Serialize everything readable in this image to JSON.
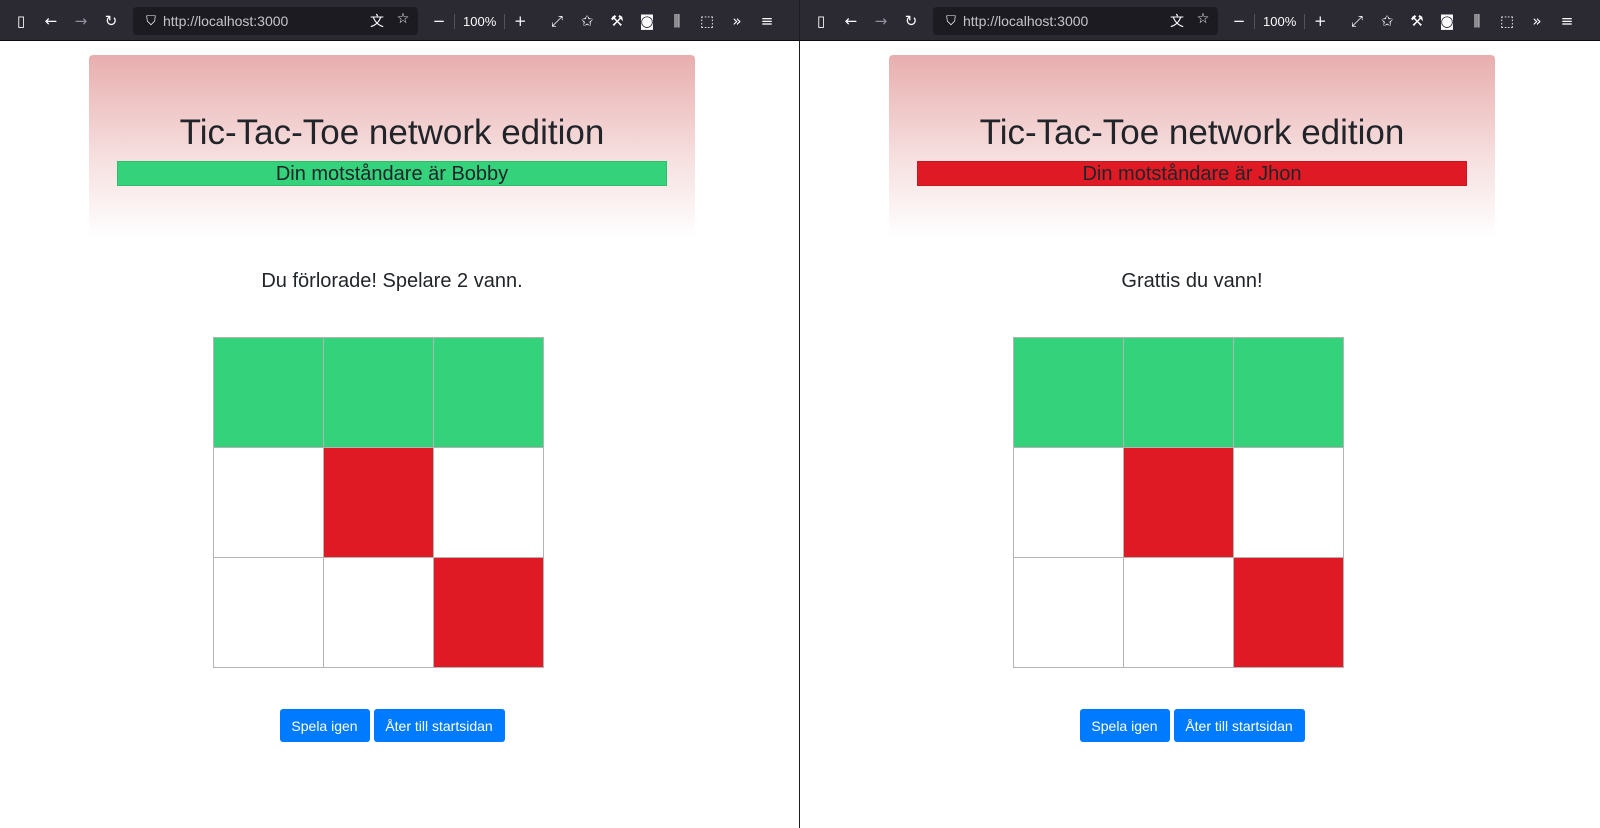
{
  "browser": {
    "url": "http://localhost:3000",
    "zoom": "100%"
  },
  "colors": {
    "green": "#34d27b",
    "red": "#e01a24",
    "empty": "#ffffff",
    "button": "#007bff"
  },
  "windows": [
    {
      "title": "Tic-Tac-Toe network edition",
      "opponent_text": "Din motståndare är Bobby",
      "opponent_color": "#34d27b",
      "status": "Du förlorade! Spelare 2 vann.",
      "board": [
        "green",
        "green",
        "green",
        "empty",
        "red",
        "empty",
        "empty",
        "empty",
        "red"
      ],
      "play_again": "Spela igen",
      "back_home": "Åter till startsidan"
    },
    {
      "title": "Tic-Tac-Toe network edition",
      "opponent_text": "Din motståndare är Jhon",
      "opponent_color": "#e01a24",
      "status": "Grattis du vann!",
      "board": [
        "green",
        "green",
        "green",
        "empty",
        "red",
        "empty",
        "empty",
        "empty",
        "red"
      ],
      "play_again": "Spela igen",
      "back_home": "Åter till startsidan"
    }
  ]
}
